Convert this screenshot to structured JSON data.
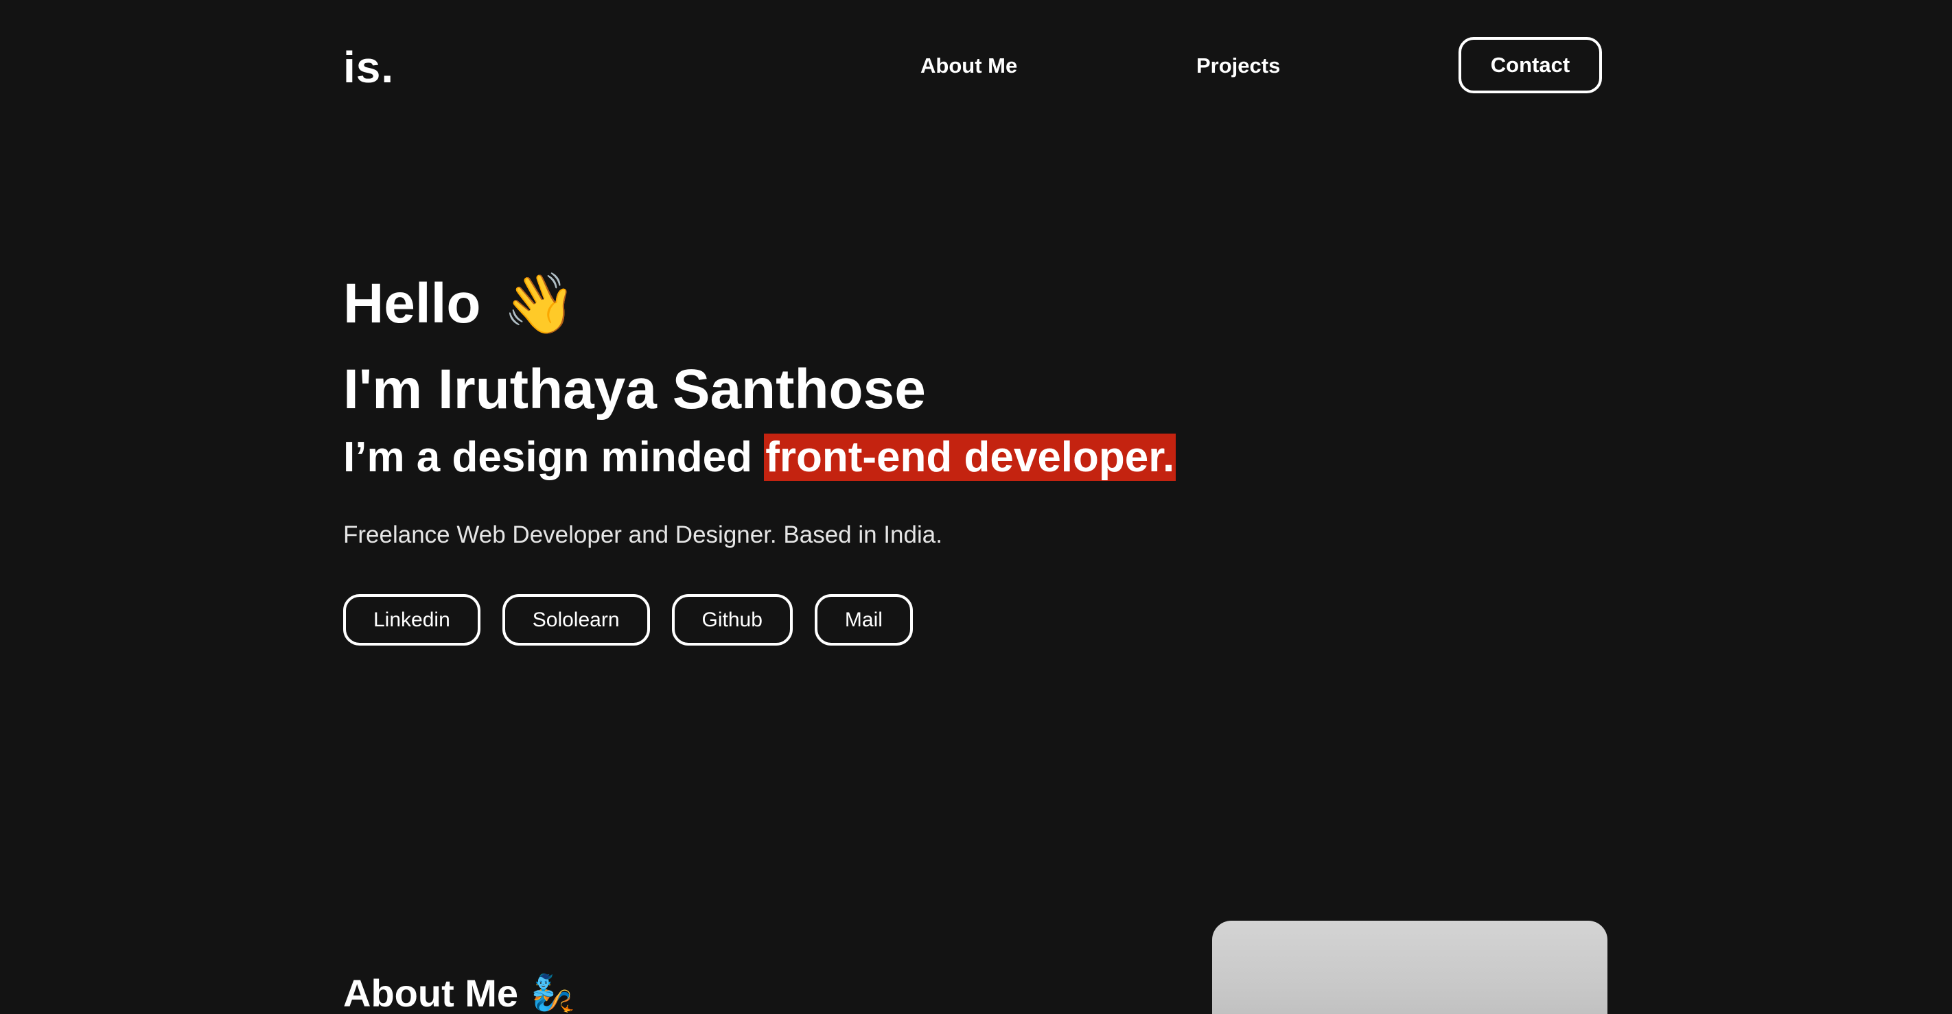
{
  "header": {
    "logo": "is.",
    "nav": {
      "about": "About Me",
      "projects": "Projects",
      "contact": "Contact"
    }
  },
  "hero": {
    "greeting": "Hello",
    "greeting_emoji": "👋",
    "name": "I'm Iruthaya Santhose",
    "tagline_prefix": "I’m a design minded ",
    "tagline_highlight": "front-end developer.",
    "subtitle": "Freelance Web Developer and Designer. Based in India.",
    "social": [
      "Linkedin",
      "Sololearn",
      "Github",
      "Mail"
    ]
  },
  "about": {
    "heading": "About Me",
    "heading_emoji": "🧞"
  },
  "colors": {
    "background": "#131313",
    "highlight": "#c42310",
    "text": "#ffffff"
  }
}
